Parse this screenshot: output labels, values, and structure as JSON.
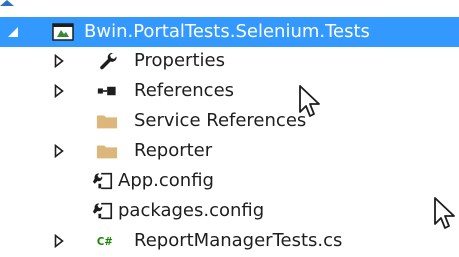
{
  "tree": {
    "project": {
      "label": "Bwin.PortalTests.Selenium.Tests",
      "icon": "test-project-icon",
      "expanded": true,
      "selected": true
    },
    "items": [
      {
        "label": "Properties",
        "icon": "wrench-icon",
        "expander": "collapsed"
      },
      {
        "label": "References",
        "icon": "references-icon",
        "expander": "collapsed"
      },
      {
        "label": "Service References",
        "icon": "folder-icon",
        "expander": "none"
      },
      {
        "label": "Reporter",
        "icon": "folder-icon",
        "expander": "collapsed"
      },
      {
        "label": "App.config",
        "icon": "config-file-icon",
        "expander": "none"
      },
      {
        "label": "packages.config",
        "icon": "config-file-icon",
        "expander": "none"
      },
      {
        "label": "ReportManagerTests.cs",
        "icon": "csharp-file-icon",
        "expander": "collapsed"
      }
    ]
  },
  "colors": {
    "selection": "#3399ff",
    "folder": "#dcb67a",
    "csharp": "#178600",
    "text": "#1e1e1e"
  }
}
